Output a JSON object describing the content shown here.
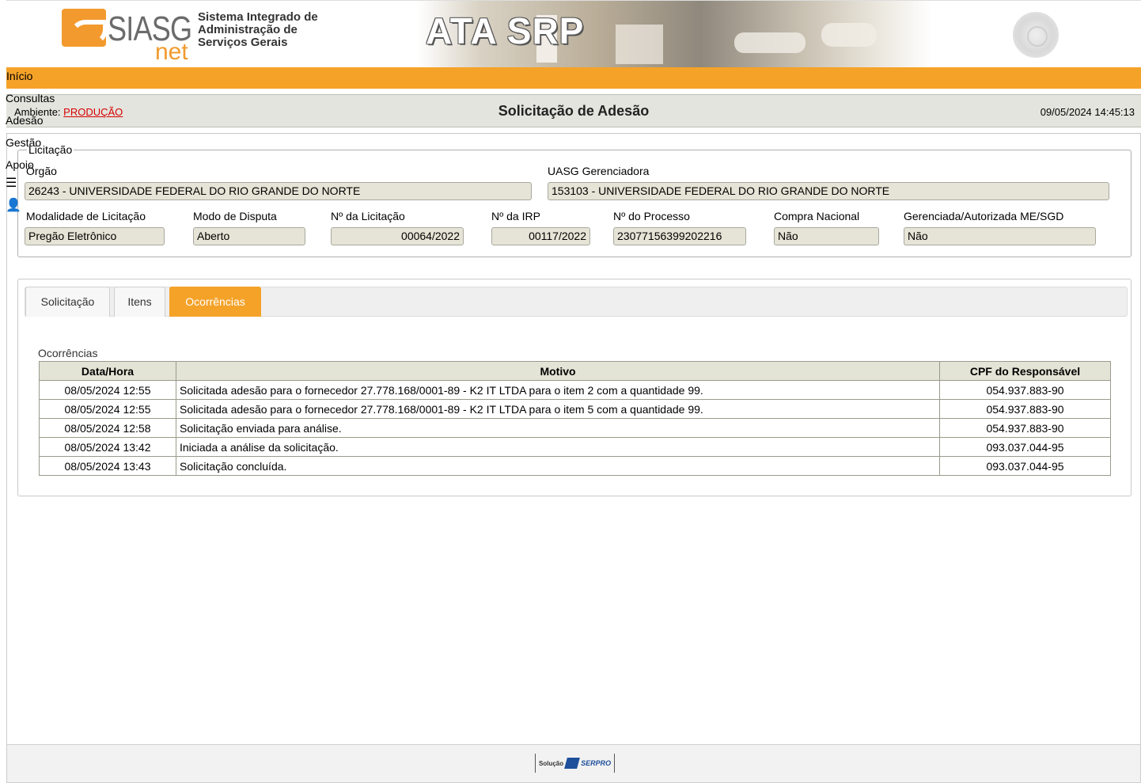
{
  "header": {
    "logo_main": "SIASG",
    "logo_sub": "net",
    "system_name_lines": [
      "Sistema Integrado de",
      "Administração de",
      "Serviços Gerais"
    ],
    "app_title": "ATA SRP",
    "coat_icon": "brazil-coat-of-arms-icon"
  },
  "nav": {
    "home": "Início",
    "items": [
      "Consultas",
      "Adesão",
      "Gestão",
      "Apoio"
    ],
    "menu_icon": "hamburger-menu-icon",
    "user_icon": "user-icon"
  },
  "title_bar": {
    "env_label": "Ambiente:",
    "env_value": "PRODUÇÃO",
    "page_title": "Solicitação de Adesão",
    "datetime": "09/05/2024 14:45:13"
  },
  "licitacao": {
    "legend": "Licitação",
    "orgao": {
      "label": "Órgão",
      "value": "26243 - UNIVERSIDADE FEDERAL DO RIO GRANDE DO NORTE"
    },
    "uasg": {
      "label": "UASG Gerenciadora",
      "value": "153103 - UNIVERSIDADE FEDERAL DO RIO GRANDE DO NORTE"
    },
    "modalidade": {
      "label": "Modalidade de Licitação",
      "value": "Pregão Eletrônico"
    },
    "modo_disputa": {
      "label": "Modo de Disputa",
      "value": "Aberto"
    },
    "num_licitacao": {
      "label": "Nº da Licitação",
      "value": "00064/2022"
    },
    "num_irp": {
      "label": "Nº da IRP",
      "value": "00117/2022"
    },
    "num_processo": {
      "label": "Nº do Processo",
      "value": "23077156399202216"
    },
    "compra_nacional": {
      "label": "Compra Nacional",
      "value": "Não"
    },
    "gerenciada": {
      "label": "Gerenciada/Autorizada ME/SGD",
      "value": "Não"
    }
  },
  "tabs": [
    {
      "label": "Solicitação",
      "active": false
    },
    {
      "label": "Itens",
      "active": false
    },
    {
      "label": "Ocorrências",
      "active": true
    }
  ],
  "ocorrencias": {
    "caption": "Ocorrências",
    "columns": [
      "Data/Hora",
      "Motivo",
      "CPF do Responsável"
    ],
    "rows": [
      [
        "08/05/2024 12:55",
        "Solicitada adesão para o fornecedor 27.778.168/0001-89 - K2 IT LTDA para o item 2 com a quantidade 99.",
        "054.937.883-90"
      ],
      [
        "08/05/2024 12:55",
        "Solicitada adesão para o fornecedor 27.778.168/0001-89 - K2 IT LTDA para o item 5 com a quantidade 99.",
        "054.937.883-90"
      ],
      [
        "08/05/2024 12:58",
        "Solicitação enviada para análise.",
        "054.937.883-90"
      ],
      [
        "08/05/2024 13:42",
        "Iniciada a análise da solicitação.",
        "093.037.044-95"
      ],
      [
        "08/05/2024 13:43",
        "Solicitação concluída.",
        "093.037.044-95"
      ]
    ]
  },
  "footer": {
    "solucao": "Solução",
    "brand": "SERPRO"
  },
  "colors": {
    "accent_orange": "#f5a229",
    "field_bg": "#e6e4d6",
    "env_red": "#d40000"
  }
}
